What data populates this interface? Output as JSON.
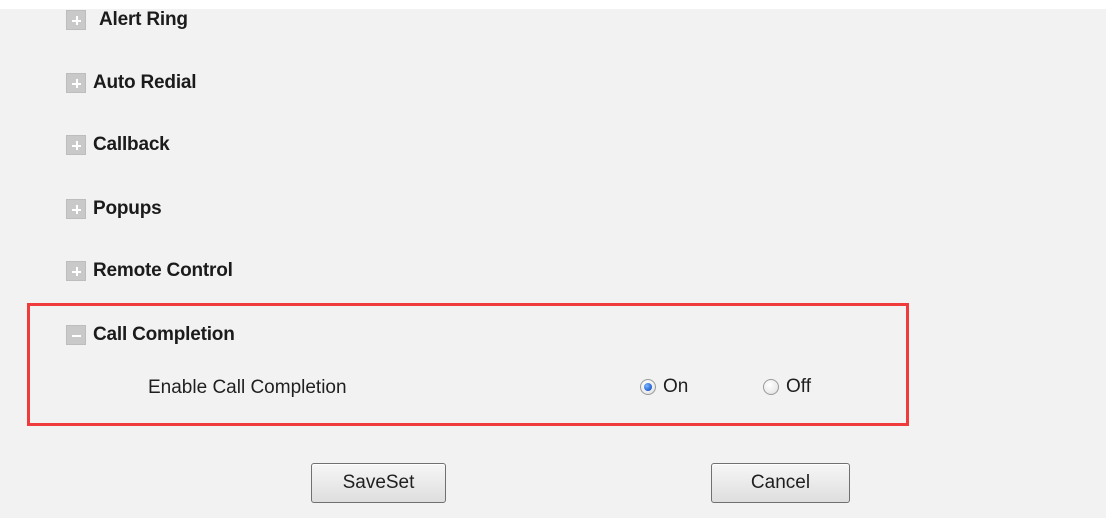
{
  "sections": [
    {
      "title": "Alert Ring",
      "state": "collapsed"
    },
    {
      "title": "Auto Redial",
      "state": "collapsed"
    },
    {
      "title": "Callback",
      "state": "collapsed"
    },
    {
      "title": "Popups",
      "state": "collapsed"
    },
    {
      "title": "Remote Control",
      "state": "collapsed"
    },
    {
      "title": "Call Completion",
      "state": "expanded"
    }
  ],
  "call_completion": {
    "setting_label": "Enable Call Completion",
    "options": [
      "On",
      "Off"
    ],
    "selected": "On"
  },
  "buttons": {
    "save_label": "SaveSet",
    "cancel_label": "Cancel"
  },
  "colors": {
    "highlight_border": "#ef3b3b",
    "background": "#f2f2f2"
  }
}
